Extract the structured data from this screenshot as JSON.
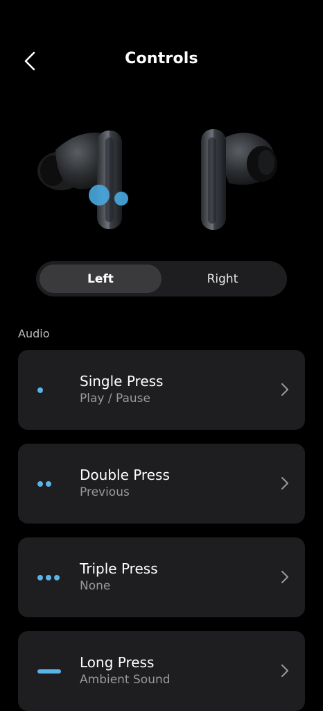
{
  "header": {
    "title": "Controls",
    "back_icon": "chevron-left-icon"
  },
  "earbuds": {
    "left_image": "left-earbud-image",
    "right_image": "right-earbud-image",
    "highlight_color": "#4aa8e0"
  },
  "segment": {
    "left_label": "Left",
    "right_label": "Right",
    "selected": "Left"
  },
  "section": {
    "label": "Audio"
  },
  "controls": [
    {
      "name": "Single Press",
      "value": "Play / Pause",
      "indicator": "single-dot-icon"
    },
    {
      "name": "Double Press",
      "value": "Previous",
      "indicator": "double-dot-icon"
    },
    {
      "name": "Triple Press",
      "value": "None",
      "indicator": "triple-dot-icon"
    },
    {
      "name": "Long Press",
      "value": "Ambient Sound",
      "indicator": "long-press-dash-icon"
    }
  ],
  "colors": {
    "accent": "#5ab4e8",
    "card_bg": "#1e1e20",
    "background": "#000000"
  }
}
